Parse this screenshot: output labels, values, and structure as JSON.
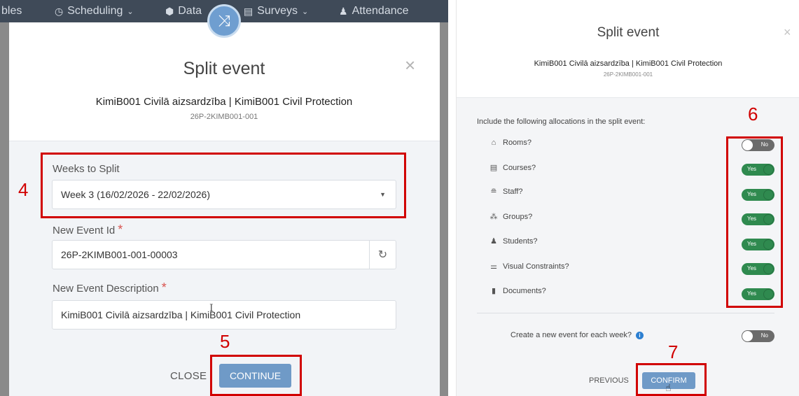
{
  "left": {
    "nav": {
      "partial_left": "bles",
      "scheduling": "Scheduling",
      "data": "Data",
      "surveys": "Surveys",
      "attendance": "Attendance"
    },
    "title": "Split event",
    "subtitle": "KimiB001 Civilā aizsardzība | KimiB001 Civil Protection",
    "event_code": "26P-2KIMB001-001",
    "weeks_label": "Weeks to Split",
    "weeks_value": "Week 3 (16/02/2026 - 22/02/2026)",
    "new_id_label": "New Event Id",
    "new_id_value": "26P-2KIMB001-001-00003",
    "new_desc_label": "New Event Description",
    "new_desc_value": "KimiB001 Civilā aizsardzība | KimiB001 Civil Protection",
    "required_mark": "*",
    "close_label": "CLOSE",
    "continue_label": "CONTINUE"
  },
  "right": {
    "title": "Split event",
    "subtitle": "KimiB001 Civilā aizsardzība | KimiB001 Civil Protection",
    "event_code": "26P-2KIMB001-001",
    "include_label": "Include the following allocations in the split event:",
    "allocations": [
      {
        "label": "Rooms?",
        "icon": "home-icon",
        "value": "No"
      },
      {
        "label": "Courses?",
        "icon": "course-icon",
        "value": "Yes"
      },
      {
        "label": "Staff?",
        "icon": "staff-icon",
        "value": "Yes"
      },
      {
        "label": "Groups?",
        "icon": "groups-icon",
        "value": "Yes"
      },
      {
        "label": "Students?",
        "icon": "student-icon",
        "value": "Yes"
      },
      {
        "label": "Visual Constraints?",
        "icon": "sliders-icon",
        "value": "Yes"
      },
      {
        "label": "Documents?",
        "icon": "document-icon",
        "value": "Yes"
      }
    ],
    "create_label": "Create a new event for each week?",
    "create_value": "No",
    "previous_label": "PREVIOUS",
    "confirm_label": "CONFIRM"
  },
  "annotations": [
    "4",
    "5",
    "6",
    "7"
  ],
  "colors": {
    "accent": "#6f9ac7",
    "toggle_on": "#2f8a4f",
    "toggle_off": "#6b6b6b",
    "annotation": "#d10000",
    "nav_bg": "#3f4a58"
  }
}
